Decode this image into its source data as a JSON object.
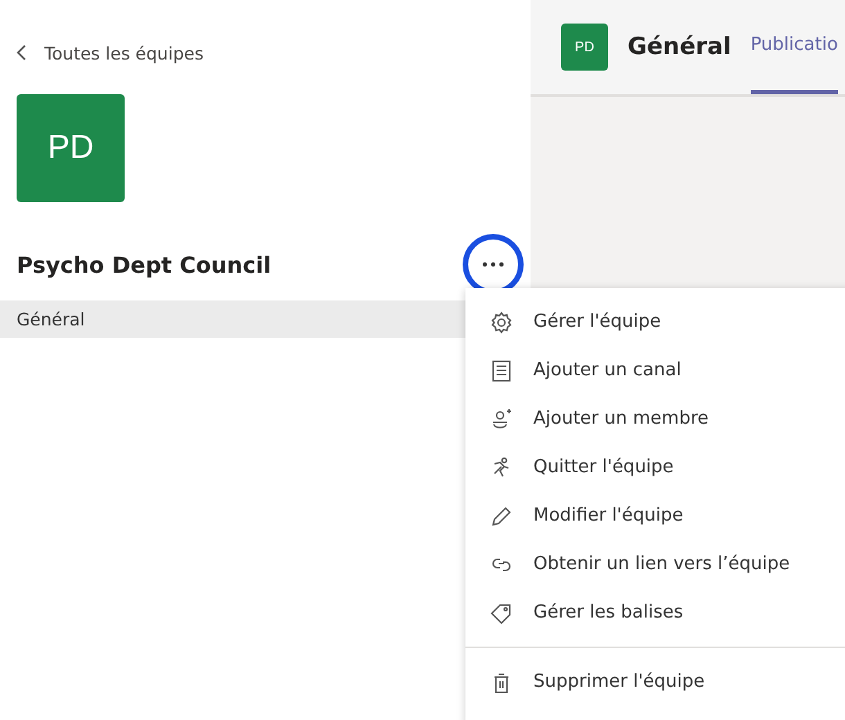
{
  "sidebar": {
    "back_link": "Toutes les équipes",
    "team_avatar": "PD",
    "team_name": "Psycho Dept Council",
    "more_button_highlighted": true,
    "channels": [
      {
        "label": "Général",
        "selected": true
      }
    ]
  },
  "header": {
    "avatar": "PD",
    "channel": "Général",
    "tabs": [
      {
        "label": "Publicatio",
        "selected": true
      }
    ]
  },
  "menu": {
    "items": [
      {
        "kind": "gear",
        "label": "Gérer l'équipe",
        "divider_before": false
      },
      {
        "kind": "channel",
        "label": "Ajouter un canal",
        "divider_before": false
      },
      {
        "kind": "member",
        "label": "Ajouter un membre",
        "divider_before": false
      },
      {
        "kind": "leave",
        "label": "Quitter l'équipe",
        "divider_before": false
      },
      {
        "kind": "edit",
        "label": "Modifier l'équipe",
        "divider_before": false
      },
      {
        "kind": "link",
        "label": "Obtenir un lien vers l’équipe",
        "divider_before": false
      },
      {
        "kind": "tag",
        "label": "Gérer les balises",
        "divider_before": false
      },
      {
        "kind": "trash",
        "label": "Supprimer l'équipe",
        "divider_before": true
      }
    ]
  }
}
